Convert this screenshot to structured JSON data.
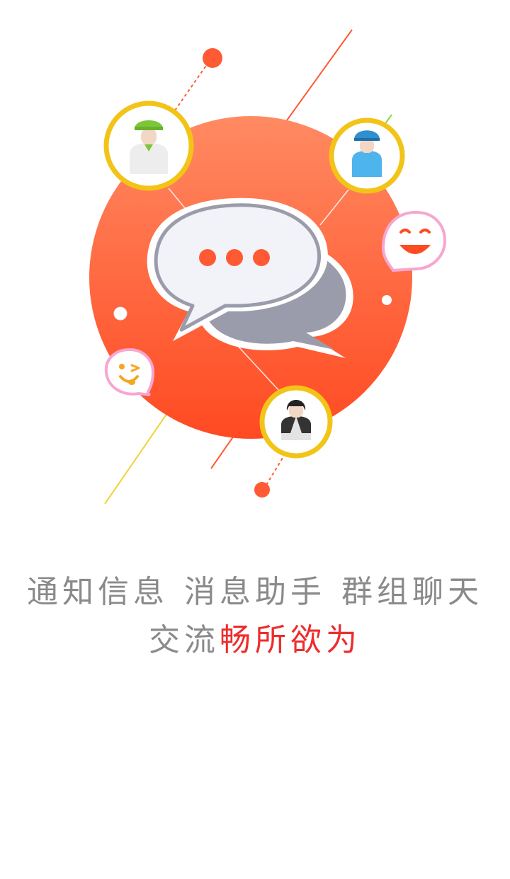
{
  "tagline": {
    "line1": [
      "通知信息",
      "消息助手",
      "群组聊天"
    ],
    "line2_plain": "交流",
    "line2_highlight": "畅所欲为"
  },
  "colors": {
    "circle_top": "#ff8a62",
    "circle_bottom": "#ff4a22",
    "avatar_ring": "#f2c418",
    "bubble_front": "#f2f3f8",
    "bubble_back": "#9b9cab",
    "dots": "#ff5a33",
    "highlight_text": "#ee2d2d",
    "plain_text": "#8a8a8a",
    "emoji_border": "#f7a6d0",
    "emoji_face": "#ff4a22",
    "wink_face": "#f5a623"
  },
  "icons": [
    "chat-bubbles-icon",
    "worker-avatar-icon",
    "engineer-avatar-icon",
    "user-avatar-icon",
    "smile-emoji-icon",
    "wink-emoji-icon"
  ]
}
